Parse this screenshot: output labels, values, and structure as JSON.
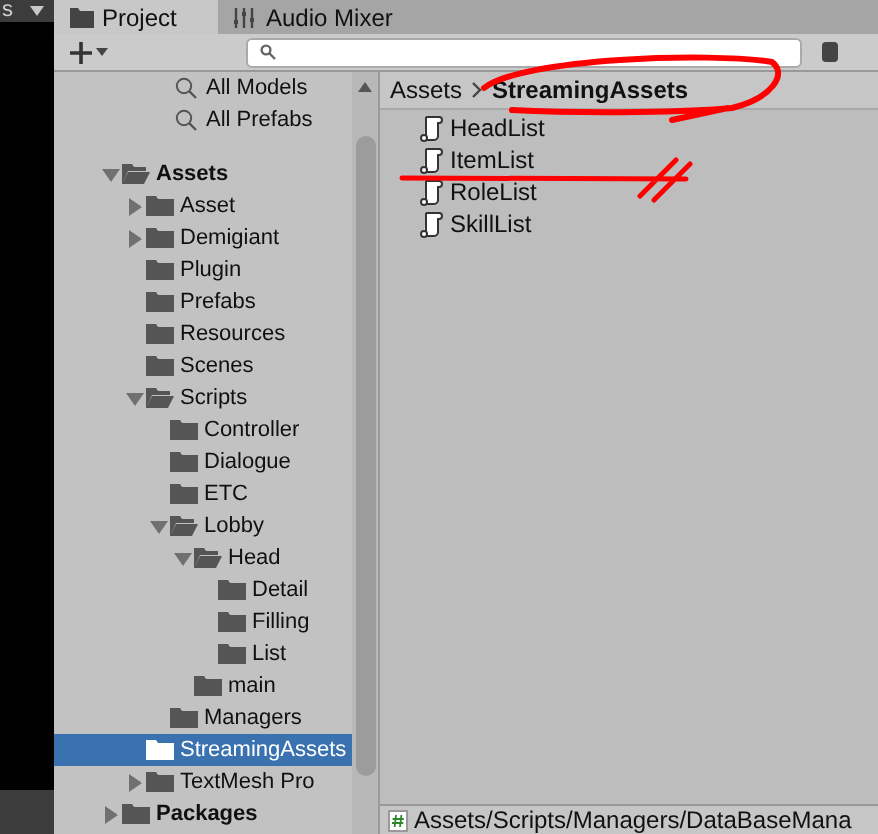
{
  "left_panel": {
    "tab_fragment": "s"
  },
  "tabs": [
    {
      "label": "Project",
      "selected": true
    },
    {
      "label": "Audio Mixer",
      "selected": false
    }
  ],
  "favorites": [
    {
      "label": "All Models"
    },
    {
      "label": "All Prefabs"
    }
  ],
  "tree": [
    {
      "label": "Assets",
      "expanded": true,
      "selected": false,
      "children": [
        {
          "label": "Asset",
          "expanded": false,
          "selected": false
        },
        {
          "label": "Demigiant",
          "expanded": false,
          "selected": false
        },
        {
          "label": "Plugin",
          "selected": false
        },
        {
          "label": "Prefabs",
          "selected": false
        },
        {
          "label": "Resources",
          "selected": false
        },
        {
          "label": "Scenes",
          "selected": false
        },
        {
          "label": "Scripts",
          "expanded": true,
          "selected": false,
          "children": [
            {
              "label": "Controller",
              "selected": false
            },
            {
              "label": "Dialogue",
              "selected": false
            },
            {
              "label": "ETC",
              "selected": false
            },
            {
              "label": "Lobby",
              "expanded": true,
              "selected": false,
              "children": [
                {
                  "label": "Head",
                  "expanded": true,
                  "selected": false,
                  "children": [
                    {
                      "label": "Detail",
                      "selected": false
                    },
                    {
                      "label": "Filling",
                      "selected": false
                    },
                    {
                      "label": "List",
                      "selected": false
                    }
                  ]
                },
                {
                  "label": "main",
                  "selected": false
                }
              ]
            },
            {
              "label": "Managers",
              "selected": false
            }
          ]
        },
        {
          "label": "StreamingAssets",
          "selected": true
        },
        {
          "label": "TextMesh Pro",
          "expanded": false,
          "selected": false
        }
      ]
    },
    {
      "label": "Packages",
      "expanded": false,
      "selected": false
    }
  ],
  "breadcrumb": [
    "Assets",
    "StreamingAssets"
  ],
  "files": [
    {
      "name": "HeadList"
    },
    {
      "name": "ItemList"
    },
    {
      "name": "RoleList"
    },
    {
      "name": "SkillList"
    }
  ],
  "status_bar": {
    "path": "Assets/Scripts/Managers/DataBaseMana"
  }
}
